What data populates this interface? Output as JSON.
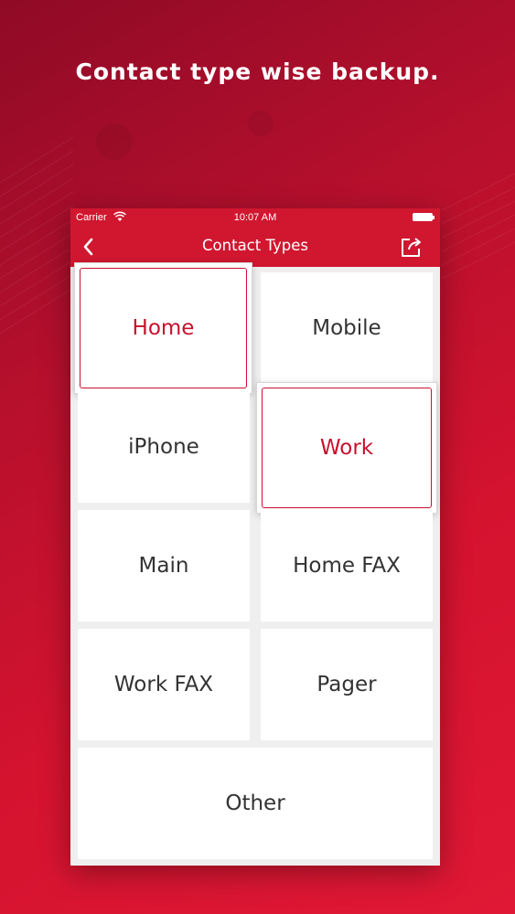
{
  "headline": "Contact type wise backup.",
  "status_bar": {
    "carrier": "Carrier",
    "time": "10:07 AM",
    "wifi_icon": "wifi-icon",
    "battery_icon": "battery-icon"
  },
  "nav_bar": {
    "title": "Contact Types",
    "back_icon": "chevron-left-icon",
    "share_icon": "share-icon"
  },
  "contact_types": [
    {
      "label": "Home",
      "selected": true
    },
    {
      "label": "Mobile",
      "selected": false
    },
    {
      "label": "iPhone",
      "selected": false
    },
    {
      "label": "Work",
      "selected": true
    },
    {
      "label": "Main",
      "selected": false
    },
    {
      "label": "Home FAX",
      "selected": false
    },
    {
      "label": "Work FAX",
      "selected": false
    },
    {
      "label": "Pager",
      "selected": false
    },
    {
      "label": "Other",
      "selected": false
    }
  ],
  "colors": {
    "accent": "#d0172f",
    "selected_text": "#c8102e",
    "tile_text": "#333333",
    "grid_background": "#efefef"
  }
}
